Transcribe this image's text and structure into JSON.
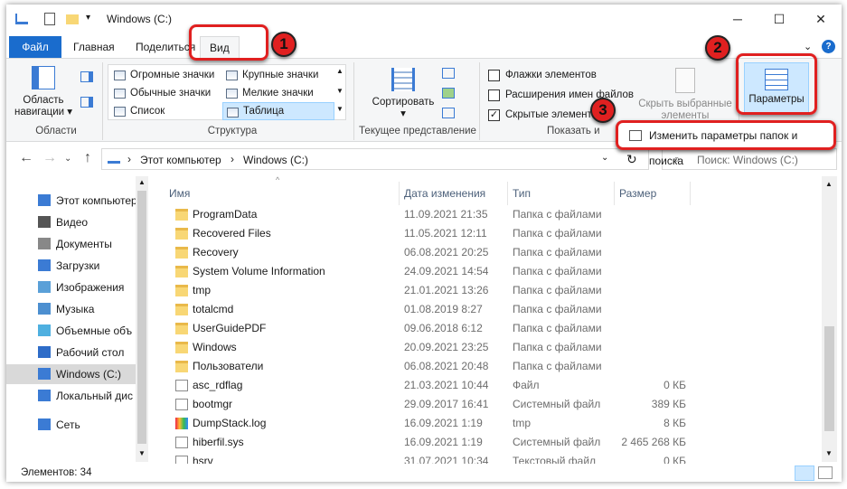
{
  "window": {
    "title": "Windows (C:)",
    "controls": {
      "minimize": "─",
      "maximize": "☐",
      "close": "✕"
    }
  },
  "tabs": [
    {
      "label": "Файл",
      "active": false
    },
    {
      "label": "Главная",
      "active": false
    },
    {
      "label": "Поделиться",
      "active": false
    },
    {
      "label": "Вид",
      "active": true
    }
  ],
  "ribbon": {
    "areas": {
      "label": "Области",
      "nav_pane": "Область навигации ▾"
    },
    "layout": {
      "label": "Структура",
      "items": [
        [
          "Огромные значки",
          "Крупные значки"
        ],
        [
          "Обычные значки",
          "Мелкие значки"
        ],
        [
          "Список",
          "Таблица"
        ]
      ],
      "selected": "Таблица"
    },
    "current_view": {
      "label": "Текущее представление",
      "sort": "Сортировать"
    },
    "show_hide": {
      "label": "Показать и",
      "checkboxes": [
        {
          "label": "Флажки элементов",
          "checked": false
        },
        {
          "label": "Расширения имен файлов",
          "checked": false
        },
        {
          "label": "Скрытые элементы",
          "checked": true
        }
      ],
      "hide_selected": "Скрыть выбранные элементы"
    },
    "options": {
      "label": "Параметры",
      "menu_item": "Изменить параметры папок и поиска"
    }
  },
  "address": {
    "path": [
      "Этот компьютер",
      "Windows (C:)"
    ],
    "search_placeholder": "Поиск: Windows (C:)"
  },
  "nav_pane": [
    {
      "label": "Этот компьютер",
      "icon": "computer-icon",
      "selected": false
    },
    {
      "label": "Видео",
      "icon": "video-icon",
      "selected": false
    },
    {
      "label": "Документы",
      "icon": "documents-icon",
      "selected": false
    },
    {
      "label": "Загрузки",
      "icon": "downloads-icon",
      "selected": false
    },
    {
      "label": "Изображения",
      "icon": "pictures-icon",
      "selected": false
    },
    {
      "label": "Музыка",
      "icon": "music-icon",
      "selected": false
    },
    {
      "label": "Объемные объ",
      "icon": "3d-objects-icon",
      "selected": false
    },
    {
      "label": "Рабочий стол",
      "icon": "desktop-icon",
      "selected": false
    },
    {
      "label": "Windows (C:)",
      "icon": "drive-icon",
      "selected": true
    },
    {
      "label": "Локальный дис",
      "icon": "drive-icon",
      "selected": false
    },
    {
      "label": "Сеть",
      "icon": "network-icon",
      "selected": false
    }
  ],
  "columns": {
    "name": "Имя",
    "date": "Дата изменения",
    "type": "Тип",
    "size": "Размер"
  },
  "files": [
    {
      "name": "ProgramData",
      "date": "11.09.2021 21:35",
      "type": "Папка с файлами",
      "size": "",
      "kind": "folder"
    },
    {
      "name": "Recovered Files",
      "date": "11.05.2021 12:11",
      "type": "Папка с файлами",
      "size": "",
      "kind": "folder"
    },
    {
      "name": "Recovery",
      "date": "06.08.2021 20:25",
      "type": "Папка с файлами",
      "size": "",
      "kind": "folder"
    },
    {
      "name": "System Volume Information",
      "date": "24.09.2021 14:54",
      "type": "Папка с файлами",
      "size": "",
      "kind": "folder"
    },
    {
      "name": "tmp",
      "date": "21.01.2021 13:26",
      "type": "Папка с файлами",
      "size": "",
      "kind": "folder"
    },
    {
      "name": "totalcmd",
      "date": "01.08.2019 8:27",
      "type": "Папка с файлами",
      "size": "",
      "kind": "folder"
    },
    {
      "name": "UserGuidePDF",
      "date": "09.06.2018 6:12",
      "type": "Папка с файлами",
      "size": "",
      "kind": "folder"
    },
    {
      "name": "Windows",
      "date": "20.09.2021 23:25",
      "type": "Папка с файлами",
      "size": "",
      "kind": "folder"
    },
    {
      "name": "Пользователи",
      "date": "06.08.2021 20:48",
      "type": "Папка с файлами",
      "size": "",
      "kind": "folder"
    },
    {
      "name": "asc_rdflag",
      "date": "21.03.2021 10:44",
      "type": "Файл",
      "size": "0 КБ",
      "kind": "file"
    },
    {
      "name": "bootmgr",
      "date": "29.09.2017 16:41",
      "type": "Системный файл",
      "size": "389 КБ",
      "kind": "file"
    },
    {
      "name": "DumpStack.log",
      "date": "16.09.2021 1:19",
      "type": "tmp",
      "size": "8 КБ",
      "kind": "log"
    },
    {
      "name": "hiberfil.sys",
      "date": "16.09.2021 1:19",
      "type": "Системный файл",
      "size": "2 465 268 КБ",
      "kind": "file"
    },
    {
      "name": "hsrv",
      "date": "31.07.2021 10:34",
      "type": "Текстовый файл",
      "size": "0 КБ",
      "kind": "file"
    }
  ],
  "status": {
    "count": "Элементов: 34"
  },
  "annotations": [
    "1",
    "2",
    "3"
  ],
  "colors": {
    "accent": "#1a6ccd",
    "highlight": "#e02020",
    "selected": "#cde8ff"
  }
}
